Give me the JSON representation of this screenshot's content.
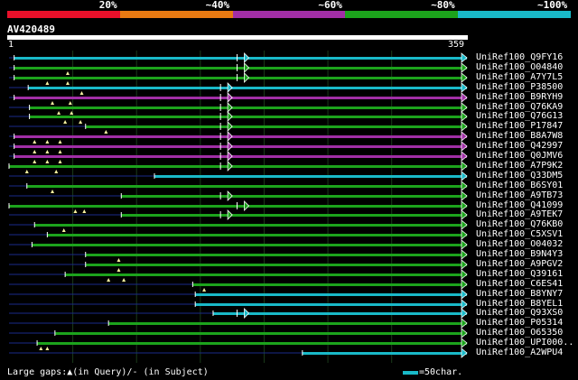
{
  "legend": {
    "segments": [
      {
        "label": "20%",
        "color": "#e8102a"
      },
      {
        "label": "~40%",
        "color": "#e87a12"
      },
      {
        "label": "~60%",
        "color": "#a12ea6"
      },
      {
        "label": "~80%",
        "color": "#1ca31c"
      },
      {
        "label": "~100%",
        "color": "#19b9c8"
      }
    ]
  },
  "query": {
    "id": "AV420489",
    "start_label": "1",
    "end_label": "359",
    "length": 359
  },
  "colors": {
    "background": "#000000",
    "cyan": "#19b9c8",
    "green": "#1ca31c",
    "purple": "#a12ea6",
    "gap_line": "#1a2a8a",
    "grid": "#1a3a1a"
  },
  "hits": [
    {
      "label": "UniRef100_Q9FY16",
      "color": "cyan",
      "start": 4,
      "end": 359,
      "qgaps": [],
      "arrows": [
        188
      ]
    },
    {
      "label": "UniRef100_O04840",
      "color": "green",
      "start": 4,
      "end": 359,
      "qgaps": [
        46
      ],
      "arrows": [
        188
      ]
    },
    {
      "label": "UniRef100_A7Y7L5",
      "color": "green",
      "start": 4,
      "end": 359,
      "qgaps": [
        30,
        46
      ],
      "arrows": [
        188
      ]
    },
    {
      "label": "UniRef100_P38500",
      "color": "cyan",
      "start": 15,
      "end": 359,
      "qgaps": [
        57
      ],
      "arrows": [
        175
      ]
    },
    {
      "label": "UniRef100_B9RYH9",
      "color": "purple",
      "start": 4,
      "end": 359,
      "qgaps": [
        34,
        48
      ],
      "arrows": [
        175
      ]
    },
    {
      "label": "UniRef100_Q76KA9",
      "color": "green",
      "start": 16,
      "end": 359,
      "qgaps": [
        39,
        49
      ],
      "arrows": [
        175
      ]
    },
    {
      "label": "UniRef100_Q76G13",
      "color": "green",
      "start": 16,
      "end": 359,
      "qgaps": [
        44,
        56
      ],
      "arrows": [
        175
      ]
    },
    {
      "label": "UniRef100_P17847",
      "color": "green",
      "start": 60,
      "end": 359,
      "qgaps": [
        76
      ],
      "arrows": [
        175
      ]
    },
    {
      "label": "UniRef100_B8A7W8",
      "color": "purple",
      "start": 4,
      "end": 359,
      "qgaps": [
        20,
        30,
        40
      ],
      "arrows": [
        175
      ]
    },
    {
      "label": "UniRef100_Q42997",
      "color": "purple",
      "start": 4,
      "end": 359,
      "qgaps": [
        20,
        30,
        40
      ],
      "arrows": [
        175
      ]
    },
    {
      "label": "UniRef100_Q0JMV6",
      "color": "purple",
      "start": 4,
      "end": 359,
      "qgaps": [
        20,
        30,
        40
      ],
      "arrows": [
        175
      ]
    },
    {
      "label": "UniRef100_A7P9K2",
      "color": "green",
      "start": 0,
      "end": 359,
      "qgaps": [
        14,
        37
      ],
      "arrows": [
        175
      ]
    },
    {
      "label": "UniRef100_Q33DM5",
      "color": "cyan",
      "start": 114,
      "end": 359,
      "qgaps": [],
      "arrows": []
    },
    {
      "label": "UniRef100_B6SY01",
      "color": "green",
      "start": 14,
      "end": 359,
      "qgaps": [
        34
      ],
      "arrows": []
    },
    {
      "label": "UniRef100_A9TB73",
      "color": "green",
      "start": 88,
      "end": 359,
      "qgaps": [],
      "arrows": [
        175
      ]
    },
    {
      "label": "UniRef100_Q41099",
      "color": "green",
      "start": 0,
      "end": 359,
      "qgaps": [
        52,
        59
      ],
      "arrows": [
        188
      ]
    },
    {
      "label": "UniRef100_A9TEK7",
      "color": "green",
      "start": 88,
      "end": 359,
      "qgaps": [],
      "arrows": [
        175
      ]
    },
    {
      "label": "UniRef100_Q76KB0",
      "color": "green",
      "start": 20,
      "end": 359,
      "qgaps": [
        43
      ],
      "arrows": []
    },
    {
      "label": "UniRef100_C5XSV1",
      "color": "green",
      "start": 30,
      "end": 359,
      "qgaps": [],
      "arrows": []
    },
    {
      "label": "UniRef100_O04032",
      "color": "green",
      "start": 18,
      "end": 359,
      "qgaps": [],
      "arrows": []
    },
    {
      "label": "UniRef100_B9N4Y3",
      "color": "green",
      "start": 60,
      "end": 359,
      "qgaps": [
        86
      ],
      "arrows": []
    },
    {
      "label": "UniRef100_A9PGV2",
      "color": "green",
      "start": 60,
      "end": 359,
      "qgaps": [
        86
      ],
      "arrows": []
    },
    {
      "label": "UniRef100_Q39161",
      "color": "green",
      "start": 44,
      "end": 359,
      "qgaps": [
        78,
        90
      ],
      "arrows": []
    },
    {
      "label": "UniRef100_C6ES41",
      "color": "green",
      "start": 144,
      "end": 359,
      "qgaps": [
        153
      ],
      "arrows": []
    },
    {
      "label": "UniRef100_B8YNY7",
      "color": "cyan",
      "start": 146,
      "end": 359,
      "qgaps": [],
      "arrows": []
    },
    {
      "label": "UniRef100_B8YEL1",
      "color": "cyan",
      "start": 146,
      "end": 359,
      "qgaps": [],
      "arrows": []
    },
    {
      "label": "UniRef100_Q93XS0",
      "color": "cyan",
      "start": 160,
      "end": 359,
      "qgaps": [],
      "arrows": [
        188
      ]
    },
    {
      "label": "UniRef100_P05314",
      "color": "green",
      "start": 78,
      "end": 359,
      "qgaps": [],
      "arrows": []
    },
    {
      "label": "UniRef100_O65350",
      "color": "green",
      "start": 36,
      "end": 359,
      "qgaps": [],
      "arrows": []
    },
    {
      "label": "UniRef100_UPI000..",
      "color": "green",
      "start": 22,
      "end": 359,
      "qgaps": [
        25,
        30
      ],
      "arrows": []
    },
    {
      "label": "UniRef100_A2WPU4",
      "color": "cyan",
      "start": 230,
      "end": 359,
      "qgaps": [],
      "arrows": []
    }
  ],
  "footer": {
    "gaps_note": "Large gaps:▲(in Query)/- (in Subject)",
    "scale_label": "=50char."
  }
}
